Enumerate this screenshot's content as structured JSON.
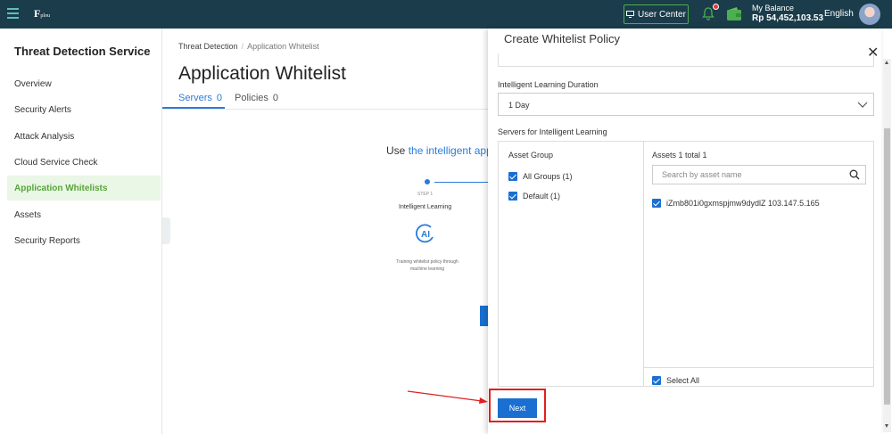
{
  "topbar": {
    "logo_text": "F",
    "logo_sub": "plou",
    "user_center_label": "User Center",
    "balance_label": "My Balance",
    "balance_amount": "Rp 54,452,103.53",
    "language": "English"
  },
  "sidebar": {
    "title": "Threat Detection Service",
    "items": [
      {
        "label": "Overview"
      },
      {
        "label": "Security Alerts"
      },
      {
        "label": "Attack Analysis"
      },
      {
        "label": "Cloud Service Check"
      },
      {
        "label": "Application Whitelists"
      },
      {
        "label": "Assets"
      },
      {
        "label": "Security Reports"
      }
    ]
  },
  "main": {
    "breadcrumb": [
      "Threat Detection",
      "Application Whitelist"
    ],
    "title": "Application Whitelist",
    "tabs": [
      {
        "label": "Servers",
        "count": "0"
      },
      {
        "label": "Policies",
        "count": "0"
      }
    ],
    "intro_text": "Use ",
    "intro_highlight": "the intelligent appl",
    "step": {
      "number": "STEP 1",
      "name": "Intelligent Learning",
      "icon_text": "AI",
      "description": "Training whitelist policy through machine learning"
    }
  },
  "drawer": {
    "title": "Create Whitelist Policy",
    "duration_label": "Intelligent Learning Duration",
    "duration_value": "1 Day",
    "servers_label": "Servers for Intelligent Learning",
    "asset_group_header": "Asset Group",
    "groups": [
      {
        "label": "All Groups (1)",
        "checked": true
      },
      {
        "label": "Default (1)",
        "checked": true
      }
    ],
    "assets_header": "Assets 1 total 1",
    "search_placeholder": "Search by asset name",
    "assets": [
      {
        "label": "iZmb801i0gxmspjmw9dydlZ 103.147.5.165",
        "checked": true
      }
    ],
    "select_all_label": "Select All",
    "next_label": "Next"
  },
  "colors": {
    "topbar_bg": "#1b3c4a",
    "accent_blue": "#1a6fd1",
    "sidebar_active_bg": "#eaf6e6",
    "sidebar_active_text": "#57a63a",
    "annotation_red": "#e02020"
  }
}
